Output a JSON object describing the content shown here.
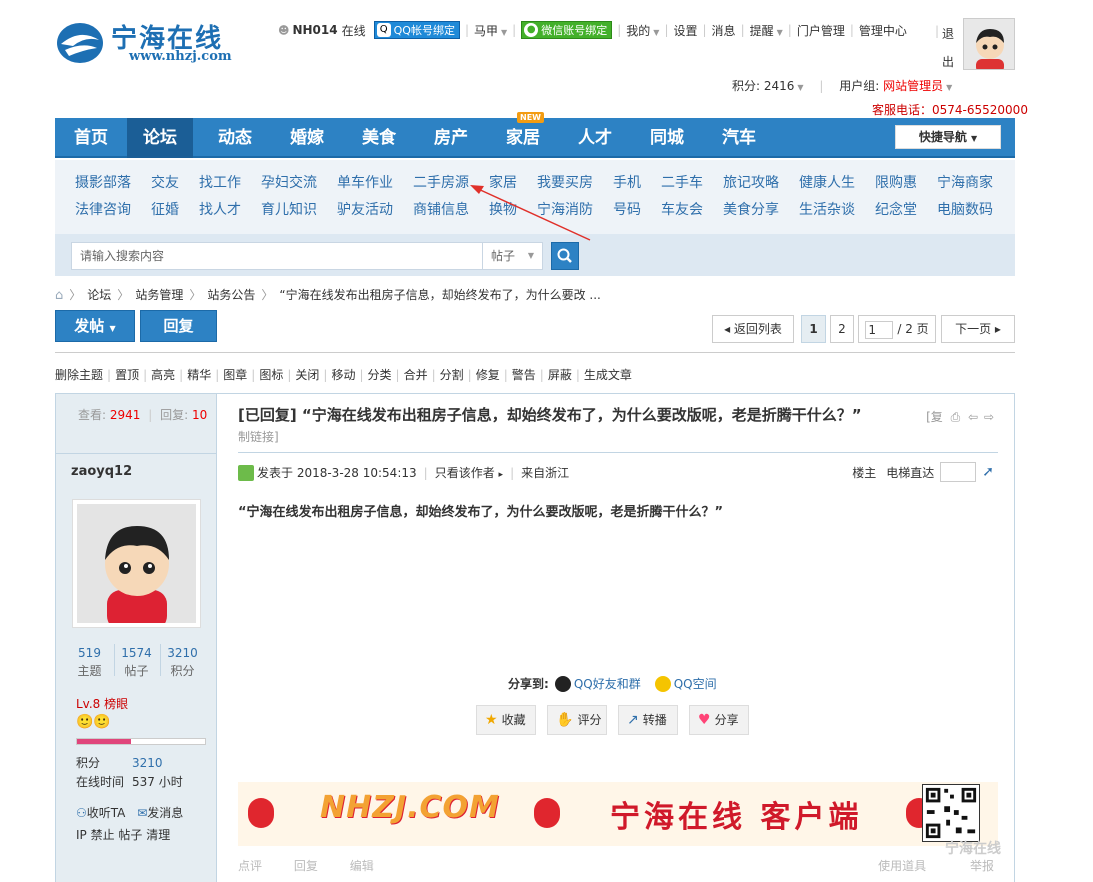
{
  "header": {
    "logo_text": "宁海在线",
    "logo_url": "www.nhzj.com",
    "user": "NH014",
    "online": "在线",
    "qq_bind": "QQ帐号绑定",
    "menu_majia": "马甲",
    "wechat_bind": "微信账号绑定",
    "menu_mine": "我的",
    "menu_settings": "设置",
    "menu_messages": "消息",
    "menu_remind": "提醒",
    "menu_portal": "门户管理",
    "menu_admin": "管理中心",
    "menu_exit": "退出",
    "credits_label": "积分: 2416",
    "usergroup_label": "用户组:",
    "usergroup_value": "网站管理员",
    "hotline": "客服电话：0574-65520000"
  },
  "nav": {
    "items": [
      "首页",
      "论坛",
      "动态",
      "婚嫁",
      "美食",
      "房产",
      "家居",
      "人才",
      "同城",
      "汽车"
    ],
    "new_badge": "NEW",
    "quick_nav": "快捷导航"
  },
  "subnav": {
    "row1": [
      "摄影部落",
      "交友",
      "找工作",
      "孕妇交流",
      "单车作业",
      "二手房源",
      "家居",
      "我要买房",
      "手机",
      "二手车",
      "旅记攻略",
      "健康人生",
      "限购惠",
      "宁海商家"
    ],
    "row2": [
      "法律咨询",
      "征婚",
      "找人才",
      "育儿知识",
      "驴友活动",
      "商铺信息",
      "换物",
      "宁海消防",
      "号码",
      "车友会",
      "美食分享",
      "生活杂谈",
      "纪念堂",
      "电脑数码"
    ]
  },
  "search": {
    "placeholder": "请输入搜索内容",
    "type": "帖子"
  },
  "breadcrumb": {
    "items": [
      "论坛",
      "站务管理",
      "站务公告",
      "“宁海在线发布出租房子信息，却始终发布了，为什么要改 ..."
    ]
  },
  "toolbar": {
    "post": "发帖",
    "reply": "回复",
    "back": "◂ 返回列表",
    "page1": "1",
    "page2": "2",
    "page_input": "1",
    "page_total": "/ 2 页",
    "next": "下一页 ▸"
  },
  "modbar": [
    "删除主题",
    "置顶",
    "高亮",
    "精华",
    "图章",
    "图标",
    "关闭",
    "移动",
    "分类",
    "合并",
    "分割",
    "修复",
    "警告",
    "屏蔽",
    "生成文章"
  ],
  "stats": {
    "views_label": "查看:",
    "views": "2941",
    "replies_label": "回复:",
    "replies": "10"
  },
  "author": {
    "name": "zaoyq12",
    "topics": "519",
    "topics_label": "主题",
    "posts": "1574",
    "posts_label": "帖子",
    "points": "3210",
    "points_label": "积分",
    "level": "Lv.8 榜眼",
    "level_progress": 0.42,
    "kv_points_label": "积分",
    "kv_points": "3210",
    "kv_online_label": "在线时间",
    "kv_online": "537 小时",
    "follow": "收听TA",
    "message": "发消息",
    "admin_links": "IP 禁止 帖子 清理"
  },
  "post": {
    "title": "[已回复] “宁海在线发布出租房子信息，却始终发布了，为什么要改版呢，老是折腾干什么？”",
    "title_tools": "[复",
    "permalink": "制链接]",
    "posted_at": "发表于 2018-3-28 10:54:13",
    "only_author": "只看该作者",
    "from": "来自浙江",
    "floor": "楼主",
    "jump": "电梯直达",
    "body": "“宁海在线发布出租房子信息，却始终发布了，为什么要改版呢，老是折腾干什么？”",
    "share_to": "分享到:",
    "share_qq": "QQ好友和群",
    "share_qzone": "QQ空间",
    "btn_fav": "收藏",
    "btn_rate": "评分",
    "btn_forward": "转播",
    "btn_share": "分享",
    "banner_left": "NHZJ.COM",
    "banner_right": "宁海在线 客户端",
    "bottom_comment": "点评",
    "bottom_reply": "回复",
    "bottom_edit": "编辑",
    "bottom_tools": "使用道具",
    "bottom_report": "举报"
  },
  "watermark": "宁海在线"
}
